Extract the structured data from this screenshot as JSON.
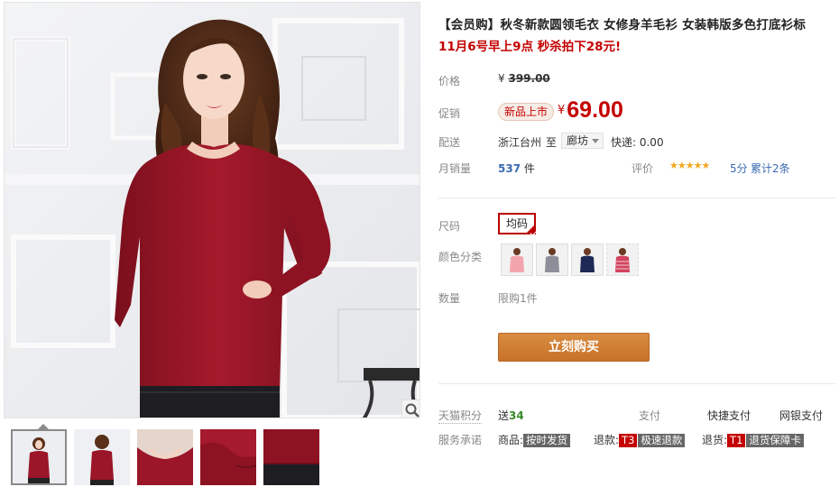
{
  "product": {
    "title": "【会员购】秋冬新款圆领毛衣 女修身羊毛衫 女装韩版多色打底衫标",
    "subtitle": "11月6号早上9点 秒杀拍下28元!"
  },
  "price": {
    "label": "价格",
    "currency": "¥",
    "original": "399.00"
  },
  "promo": {
    "label": "促销",
    "badge": "新品上市",
    "currency": "¥",
    "price": "69.00",
    "color": "#c40000"
  },
  "shipping": {
    "label": "配送",
    "from": "浙江台州",
    "to_label": "至",
    "to_city": "廊坊",
    "fee": "快递: 0.00"
  },
  "sales": {
    "label": "月销量",
    "count": "537",
    "unit": "件",
    "rating_label": "评价",
    "stars": "★★★★★",
    "score": "5分",
    "reviews": "累计2条"
  },
  "options": {
    "size_label": "尺码",
    "size_value": "均码",
    "color_label": "颜色分类",
    "swatch_icons": [
      "pink-sweater",
      "grey-sweater",
      "navy-sweater",
      "pink-striped-sweater"
    ],
    "qty_label": "数量",
    "qty_limit": "限购1件"
  },
  "buy_button": "立刻购买",
  "points": {
    "label": "天猫积分",
    "value_prefix": "送",
    "value": "34",
    "pay_label": "支付",
    "quick_pay": "快捷支付",
    "bank_pay": "网银支付"
  },
  "service": {
    "label": "服务承诺",
    "goods_label": "商品:",
    "goods_tag": "按时发货",
    "refund_label": "退款:",
    "refund_t": "T3",
    "refund_tag": "极速退款",
    "return_label": "退货:",
    "return_t": "T1",
    "return_tag": "退货保障卡"
  },
  "colors": {
    "accent": "#c40000",
    "button": "#c8722a",
    "sweater": "#8e1322"
  }
}
